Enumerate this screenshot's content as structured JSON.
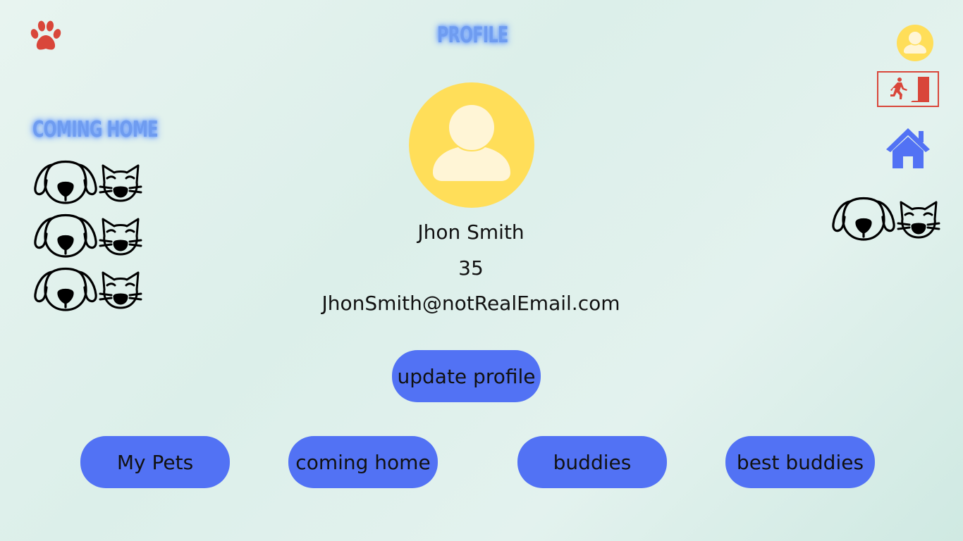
{
  "header": {
    "title": "PROFILE"
  },
  "sidebar": {
    "title": "COMING HOME",
    "pet_rows": [
      {
        "dog_icon": "dog-face-icon",
        "cat_icon": "cat-face-icon"
      },
      {
        "dog_icon": "dog-face-icon",
        "cat_icon": "cat-face-icon"
      },
      {
        "dog_icon": "dog-face-icon",
        "cat_icon": "cat-face-icon"
      }
    ]
  },
  "profile": {
    "name": "Jhon Smith",
    "age": "35",
    "email": "JhonSmith@notRealEmail.com",
    "update_label": "update profile"
  },
  "nav": {
    "my_pets": "My Pets",
    "coming_home": "coming home",
    "buddies": "buddies",
    "best_buddies": "best buddies"
  },
  "icons": {
    "logo": "paw-icon",
    "account": "user-avatar-icon",
    "logout": "exit-door-icon",
    "home": "home-icon",
    "pets": "dog-cat-icon"
  },
  "colors": {
    "accent": "#5272f4",
    "avatar": "#ffde59",
    "logo": "#d9463a",
    "neon_title": "#6f9cf0",
    "home_icon": "#5272f4"
  }
}
